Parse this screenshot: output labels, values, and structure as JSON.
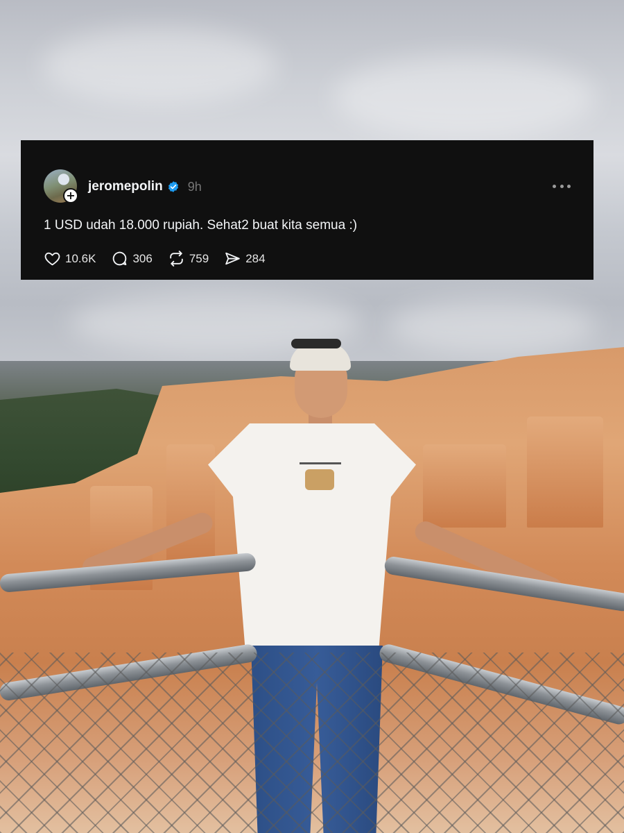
{
  "post": {
    "username": "jeromepolin",
    "timestamp": "9h",
    "text": "1 USD udah 18.000 rupiah. Sehat2 buat kita semua :)",
    "verified": true,
    "stats": {
      "likes": "10.6K",
      "replies": "306",
      "reposts": "759",
      "shares": "284"
    }
  },
  "icons": {
    "like": "heart-icon",
    "reply": "comment-bubble-icon",
    "repost": "repost-icon",
    "share": "send-icon",
    "more": "more-options-icon",
    "follow": "plus-icon",
    "verified": "verified-badge-icon"
  },
  "colors": {
    "card_background": "#101010",
    "text_primary": "#f3f5f7",
    "text_secondary": "#777777",
    "verified_blue": "#1d9bf0"
  }
}
